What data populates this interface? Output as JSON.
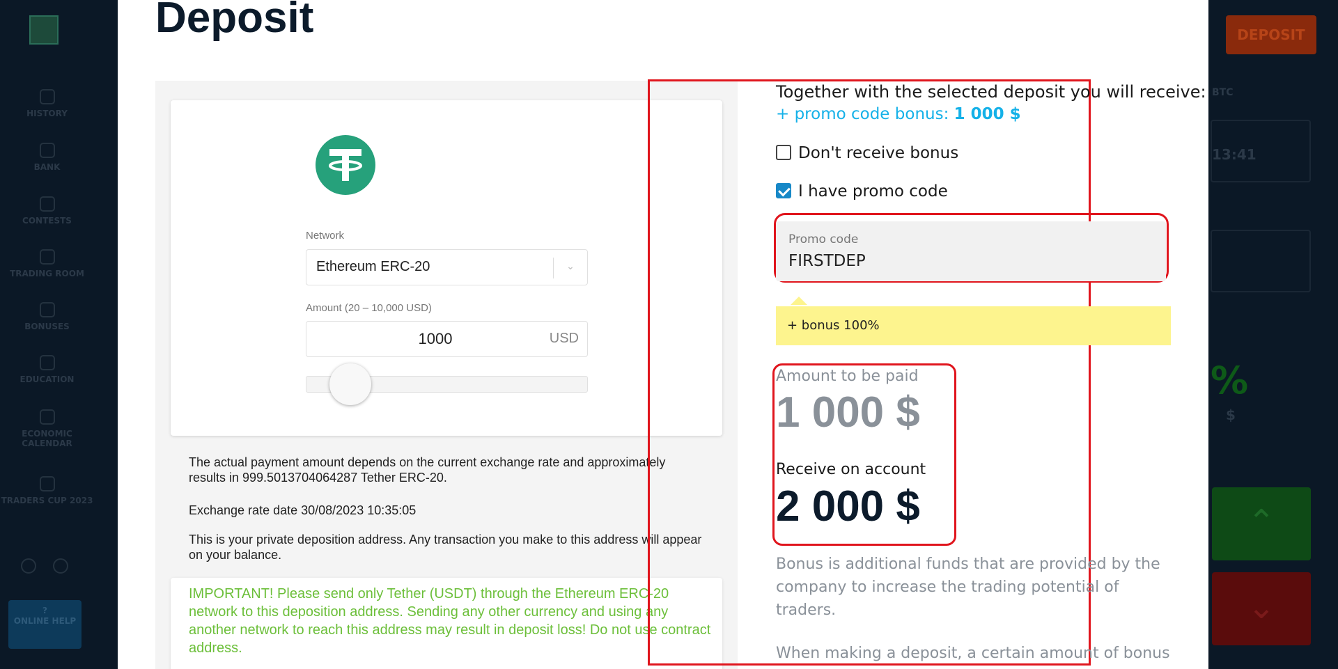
{
  "background": {
    "sidebar_items": [
      "HISTORY",
      "BANK",
      "CONTESTS",
      "TRADING ROOM",
      "BONUSES",
      "EDUCATION",
      "ECONOMIC CALENDAR",
      "TRADERS CUP 2023"
    ],
    "help_label": "ONLINE HELP",
    "deposit_button": "DEPOSIT",
    "timer": "13:41",
    "percent": "%",
    "dollar": "$",
    "pair": "BTC"
  },
  "modal": {
    "title": "Deposit",
    "network": {
      "label": "Network",
      "value": "Ethereum ERC-20"
    },
    "amount": {
      "label": "Amount (20 – 10,000 USD)",
      "value": "1000",
      "currency": "USD",
      "slider_level": 0.098
    },
    "info": {
      "exchange_note": "The actual payment amount depends on the current exchange rate and approximately results in 999.5013704064287 Tether ERC-20.",
      "rate_date": "Exchange rate date 30/08/2023 10:35:05",
      "private_address": "This is your private deposition address. Any transaction you make to this address will appear on your balance."
    },
    "important": "IMPORTANT! Please send only Tether (USDT) through the Ethereum ERC-20 network to this deposition address. Sending any other currency and using any another network to reach this address may result in deposit loss! Do not use contract address.",
    "summary": {
      "receive_heading": "Together with the selected deposit you will receive:",
      "promo_bonus_prefix": "+ promo code bonus: ",
      "promo_bonus_value": "1 000 $",
      "no_bonus_label": "Don't receive bonus",
      "no_bonus_checked": false,
      "have_promo_label": "I have promo code",
      "have_promo_checked": true,
      "promo_field_label": "Promo code",
      "promo_field_value": "FIRSTDEP",
      "promo_tip": "+ bonus 100%",
      "pay_label": "Amount to be paid",
      "pay_value": "1 000 $",
      "receive_label": "Receive on account",
      "receive_value": "2 000 $",
      "bonus_desc": "Bonus is additional funds that are provided by the company to increase the trading potential of traders.",
      "bonus_desc_2": "When making a deposit, a certain amount of bonus"
    }
  },
  "colors": {
    "highlight_red": "#e0151d",
    "promo_blue": "#15b1e8",
    "important_green": "#6cbf3a",
    "tether_green": "#26a17b",
    "tip_yellow": "#fdf48e"
  }
}
